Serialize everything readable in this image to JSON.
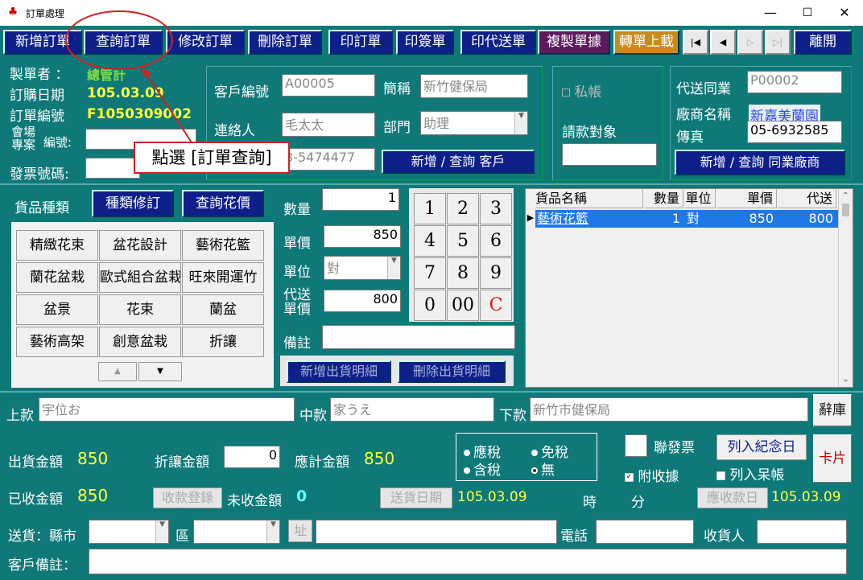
{
  "window": {
    "title": "訂單處理",
    "min": "—",
    "max": "☐",
    "close": "✕"
  },
  "toolbar": {
    "new_order": "新增訂單",
    "query_order": "查詢訂單",
    "edit_order": "修改訂單",
    "delete_order": "刪除訂單",
    "print_order": "印訂單",
    "print_sign": "印簽單",
    "print_delivery": "印代送單",
    "copy_order": "複製單據",
    "upload": "轉單上載",
    "first": "|◀",
    "prev": "◀",
    "next": "▷",
    "last": "▷|",
    "exit": "離開"
  },
  "annotation": {
    "callout": "點選 [訂單查詢]"
  },
  "header": {
    "maker_label": "製單者 ：",
    "maker_value": "總管計",
    "order_date_label": "訂購日期",
    "order_date_value": "105.03.09",
    "order_no_label": "訂單編號",
    "order_no_value": "F1050309002",
    "venue_label_1": "會場",
    "venue_label_2": "專案",
    "venue_no_label": "編號:",
    "invoice_label": "發票號碼:"
  },
  "customer": {
    "id_label": "客戶編號",
    "id_value": "A00005",
    "short_label": "簡稱",
    "short_value": "新竹健保局",
    "contact_label": "連絡人",
    "contact_value": "毛太太",
    "dept_label": "部門",
    "dept_value": "助理",
    "phone_value": "3-5474477",
    "add_btn": "新增 / 查詢  客戶"
  },
  "private": {
    "label": "私帳",
    "bill_label": "請款對象"
  },
  "vendor": {
    "label": "代送同業",
    "id_value": "P00002",
    "name_label": "廠商名稱",
    "name_value": "新嘉美蘭園",
    "fax_label": "傳真",
    "fax_value": "05-6932585",
    "add_btn": "新增 / 查詢  同業廠商"
  },
  "category": {
    "label": "貨品種類",
    "edit_btn": "種類修訂",
    "price_btn": "查詢花價",
    "items": [
      "精緻花束",
      "盆花設計",
      "藝術花籃",
      "蘭花盆栽",
      "歐式組合盆栽",
      "旺來開運竹",
      "盆景",
      "花束",
      "蘭盆",
      "藝術高架",
      "創意盆栽",
      "折讓"
    ],
    "scroll_up": "▲",
    "scroll_down": "▼"
  },
  "entry": {
    "qty_label": "數量",
    "qty_value": "1",
    "price_label": "單價",
    "price_value": "850",
    "unit_label": "單位",
    "unit_value": "對",
    "proxy_label_1": "代送",
    "proxy_label_2": "單價",
    "proxy_value": "800",
    "note_label": "備註",
    "add_detail_btn": "新增出貨明細",
    "del_detail_btn": "刪除出貨明細"
  },
  "numpad": {
    "keys": [
      "1",
      "2",
      "3",
      "4",
      "5",
      "6",
      "7",
      "8",
      "9",
      "0",
      "00",
      "C"
    ]
  },
  "detail_table": {
    "headers": [
      "貨品名稱",
      "數量",
      "單位",
      "單價",
      "代送"
    ],
    "rows": [
      {
        "name": "藝術花籃",
        "qty": "1",
        "unit": "對",
        "price": "850",
        "proxy": "800"
      }
    ]
  },
  "card": {
    "upper_label": "上款",
    "upper_value": "宇位お",
    "middle_label": "中款",
    "middle_value": "家うえ",
    "lower_label": "下款",
    "lower_value": "新竹市健保局",
    "dict_btn": "辭庫"
  },
  "amounts": {
    "ship_label": "出貨金額",
    "ship_value": "850",
    "discount_label": "折讓金額",
    "discount_value": "0",
    "due_label": "應計金額",
    "due_value": "850",
    "received_label": "已收金額",
    "received_value": "850",
    "receipt_btn": "收款登錄",
    "unpaid_label": "未收金額",
    "unpaid_value": "0",
    "delivery_date_btn": "送貨日期",
    "delivery_date_value": "105.03.09",
    "hour_label": "時",
    "min_label": "分",
    "pay_date_btn": "應收款日",
    "pay_date_value": "105.03.09"
  },
  "tax": {
    "taxable": "應稅",
    "taxfree": "免稅",
    "included": "含稅",
    "none": "無"
  },
  "flags": {
    "joint_invoice": "聯發票",
    "attach_receipt": "附收據",
    "souvenir_btn": "列入紀念日",
    "bad_debt": "列入呆帳",
    "card_btn": "卡片"
  },
  "delivery": {
    "county_label": "送貨：縣市",
    "district_label": "區",
    "address_btn": "址",
    "phone_label": "電話",
    "receiver_label": "收貨人",
    "cust_note_label": "客戶備註："
  },
  "colors": {
    "bg": "#0f7878",
    "button": "#0e1f8a",
    "highlight": "#ffff40",
    "annotation": "#d42020"
  }
}
